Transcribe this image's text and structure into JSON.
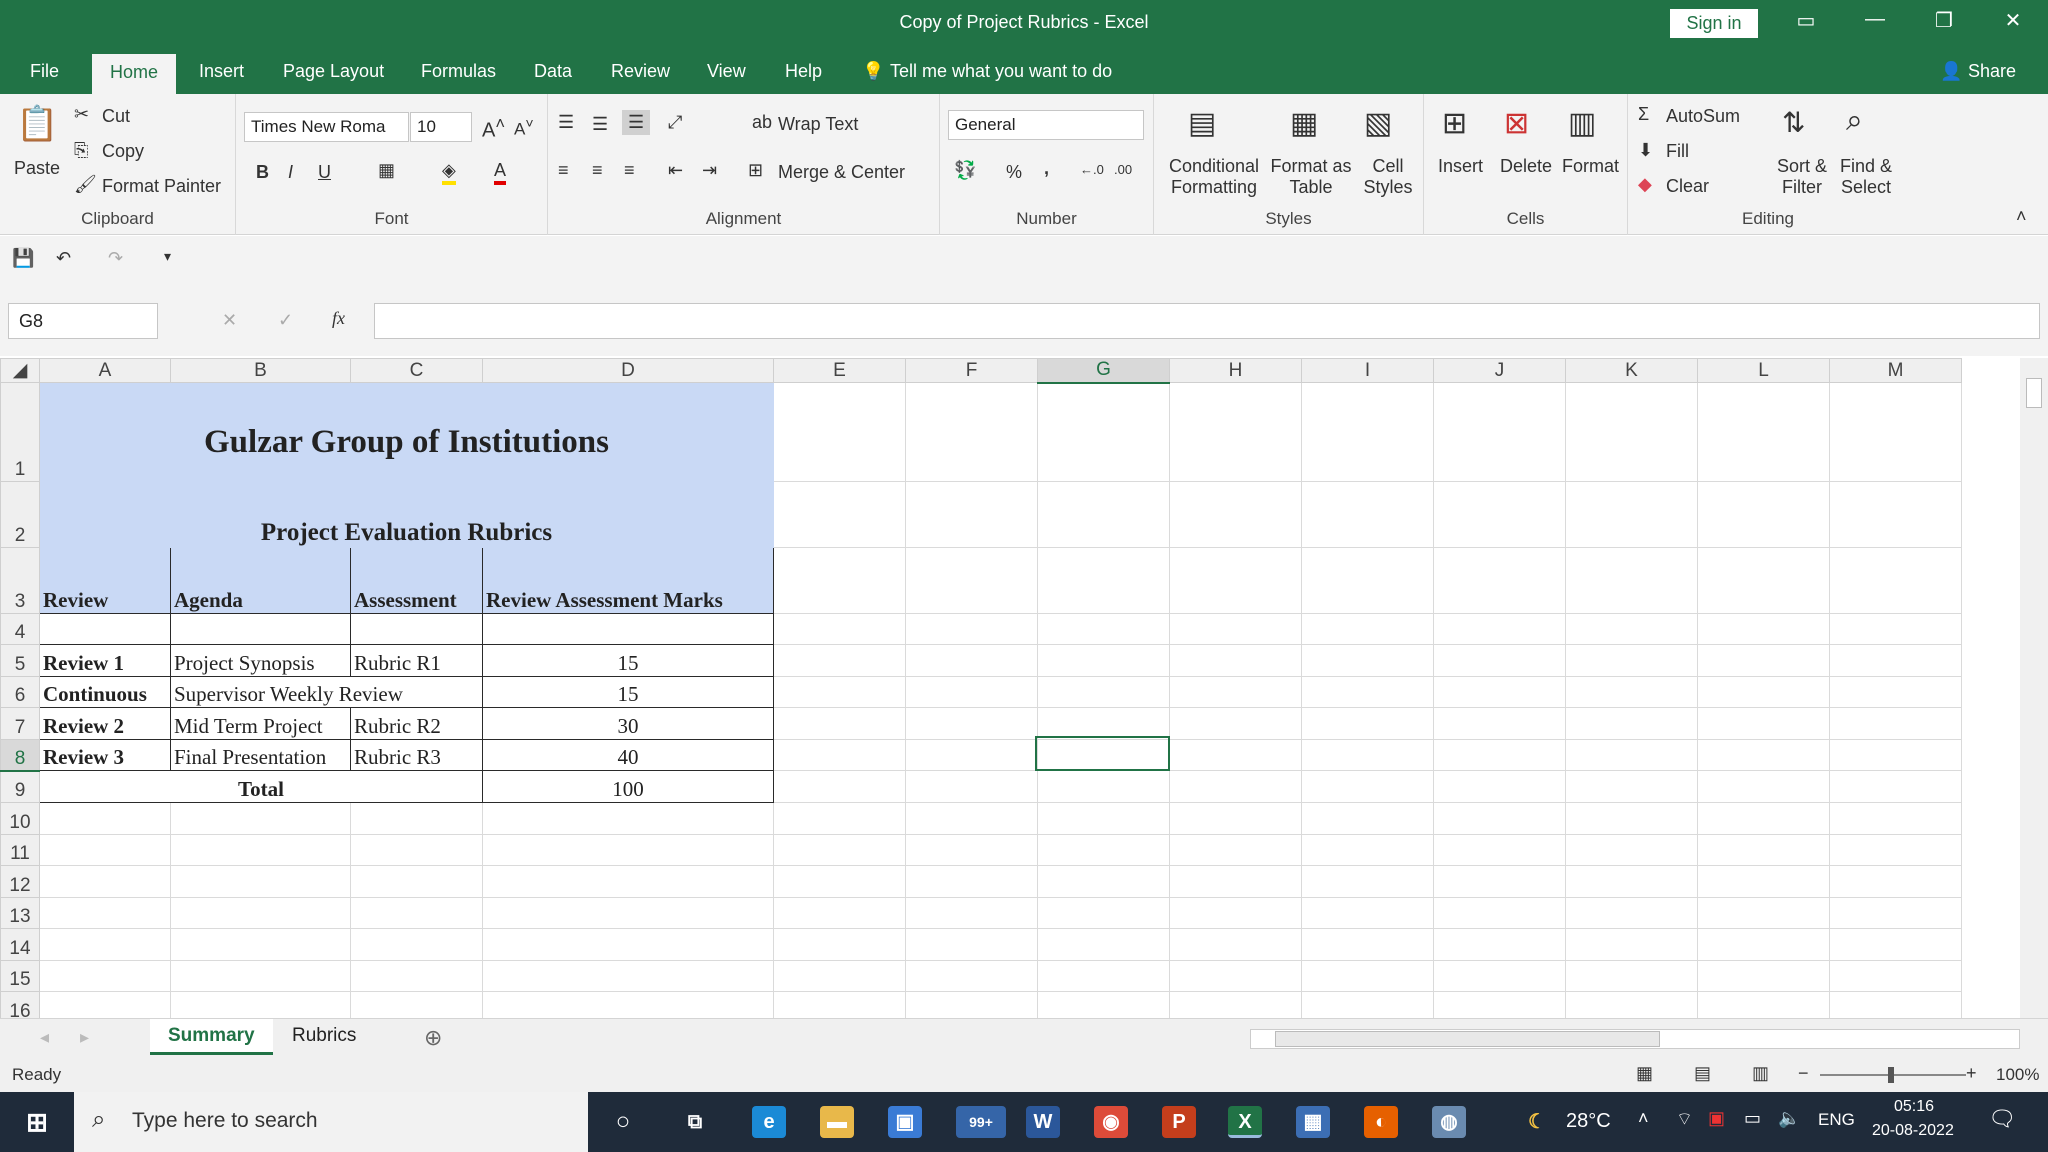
{
  "window": {
    "title": "Copy of Project Rubrics  -  Excel",
    "sign_in": "Sign in"
  },
  "menu": {
    "tabs": [
      "File",
      "Home",
      "Insert",
      "Page Layout",
      "Formulas",
      "Data",
      "Review",
      "View",
      "Help"
    ],
    "tell_me": "Tell me what you want to do",
    "share": "Share"
  },
  "ribbon": {
    "clipboard": {
      "paste": "Paste",
      "cut": "Cut",
      "copy": "Copy",
      "format_painter": "Format Painter",
      "label": "Clipboard"
    },
    "font": {
      "name": "Times New Roma",
      "size": "10",
      "bold": "B",
      "italic": "I",
      "underline": "U",
      "label": "Font"
    },
    "alignment": {
      "wrap_text": "Wrap Text",
      "merge_center": "Merge & Center",
      "label": "Alignment"
    },
    "number": {
      "format": "General",
      "percent": "%",
      "comma": ",",
      "label": "Number"
    },
    "styles": {
      "conditional": "Conditional Formatting",
      "format_table": "Format as Table",
      "cell_styles": "Cell Styles",
      "label": "Styles"
    },
    "cells": {
      "insert": "Insert",
      "delete": "Delete",
      "format": "Format",
      "label": "Cells"
    },
    "editing": {
      "autosum": "AutoSum",
      "fill": "Fill",
      "clear": "Clear",
      "sort": "Sort & Filter",
      "find": "Find & Select",
      "label": "Editing"
    }
  },
  "formula_bar": {
    "name_box": "G8",
    "fx": "fx",
    "value": ""
  },
  "columns": [
    "A",
    "B",
    "C",
    "D",
    "E",
    "F",
    "G",
    "H",
    "I",
    "J",
    "K",
    "L",
    "M"
  ],
  "rows": [
    "1",
    "2",
    "3",
    "4",
    "5",
    "6",
    "7",
    "8",
    "9",
    "10",
    "11",
    "12",
    "13",
    "14",
    "15",
    "16"
  ],
  "sheet": {
    "title": "Gulzar Group of Institutions",
    "subtitle": "Project Evaluation Rubrics",
    "headers": [
      "Review",
      "Agenda",
      "Assessment",
      "Review Assessment Marks"
    ],
    "data": [
      [
        "Review 1",
        "Project Synopsis",
        "Rubric R1",
        "15"
      ],
      [
        "Continuous",
        "Supervisor Weekly Review",
        "",
        "15"
      ],
      [
        "Review 2",
        "Mid Term Project",
        "Rubric R2",
        "30"
      ],
      [
        "Review 3",
        "Final Presentation",
        "Rubric R3",
        "40"
      ]
    ],
    "total_label": "Total",
    "total_value": "100"
  },
  "sheet_tabs": [
    "Summary",
    "Rubrics"
  ],
  "status": {
    "text": "Ready",
    "zoom": "100%"
  },
  "taskbar": {
    "search": "Type here to search",
    "badge": "99+",
    "temp": "28°C",
    "lang": "ENG",
    "time": "05:16",
    "date": "20-08-2022"
  }
}
